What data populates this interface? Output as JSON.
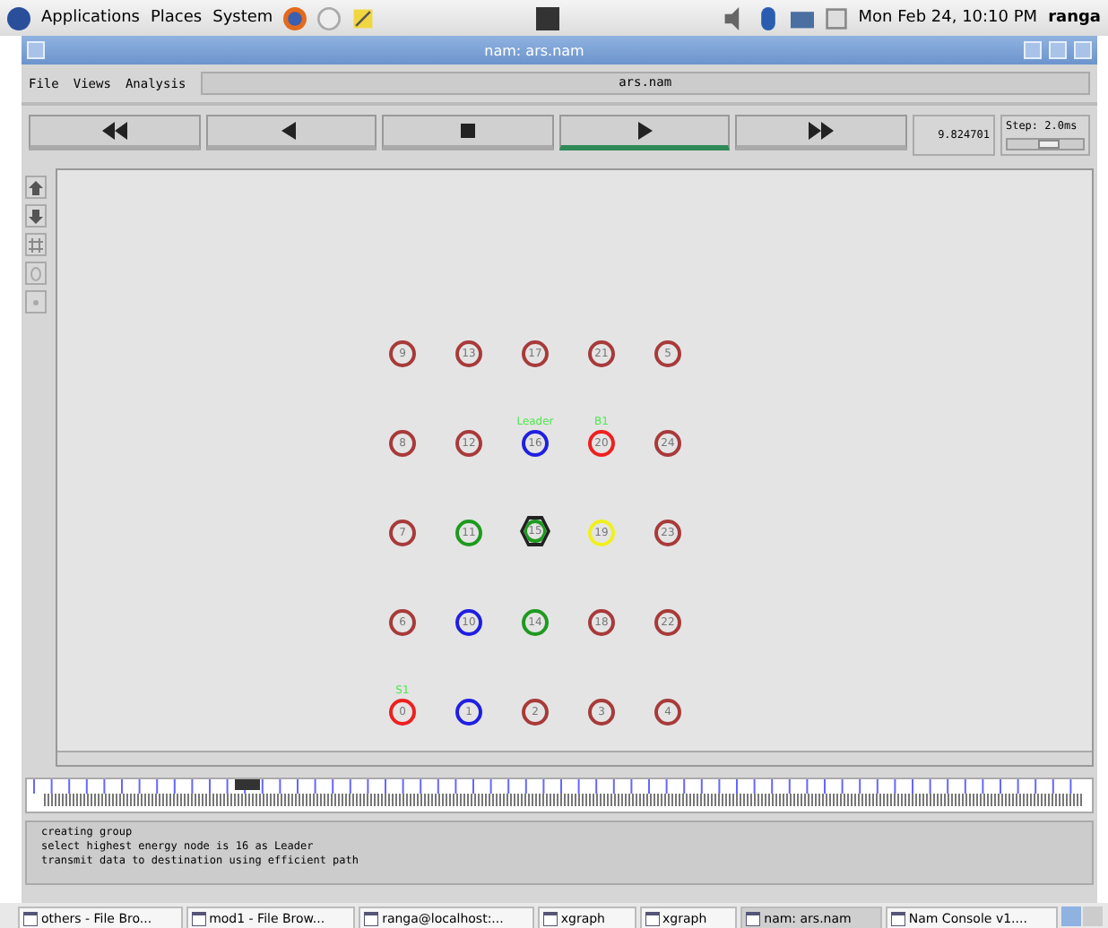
{
  "top_panel": {
    "menus": [
      "Applications",
      "Places",
      "System"
    ],
    "clock": "Mon Feb 24, 10:10 PM",
    "user": "ranga"
  },
  "window": {
    "title": "nam: ars.nam"
  },
  "menu": [
    "File",
    "Views",
    "Analysis"
  ],
  "file_label": "ars.nam",
  "controls": [
    {
      "kind": "rewind",
      "selected": false
    },
    {
      "kind": "back",
      "selected": false
    },
    {
      "kind": "stop",
      "selected": false
    },
    {
      "kind": "play",
      "selected": true
    },
    {
      "kind": "forward",
      "selected": false
    }
  ],
  "time": "9.824701",
  "step": {
    "label": "Step: 2.0ms",
    "level": 0.55
  },
  "nodes": [
    [
      {
        "label": "9",
        "color": "#a83a3a"
      },
      {
        "label": "13",
        "color": "#a83a3a"
      },
      {
        "label": "17",
        "color": "#a83a3a"
      },
      {
        "label": "21",
        "color": "#a83a3a"
      },
      {
        "label": "5",
        "color": "#a83a3a"
      }
    ],
    [
      {
        "label": "8",
        "color": "#a83a3a"
      },
      {
        "label": "12",
        "color": "#a83a3a"
      },
      {
        "label": "16",
        "color": "#1f1fe0",
        "tag": "Leader"
      },
      {
        "label": "20",
        "color": "#ee2020",
        "tag": "B1"
      },
      {
        "label": "24",
        "color": "#a83a3a"
      }
    ],
    [
      {
        "label": "7",
        "color": "#a83a3a"
      },
      {
        "label": "11",
        "color": "#1e9a1e"
      },
      {
        "label": "15",
        "color": "#1e9a1e",
        "kind": "hexagon"
      },
      {
        "label": "19",
        "color": "#f0f020"
      },
      {
        "label": "23",
        "color": "#a83a3a"
      }
    ],
    [
      {
        "label": "6",
        "color": "#a83a3a"
      },
      {
        "label": "10",
        "color": "#1f1fe0"
      },
      {
        "label": "14",
        "color": "#1e9a1e"
      },
      {
        "label": "18",
        "color": "#a83a3a"
      },
      {
        "label": "22",
        "color": "#a83a3a"
      }
    ],
    [
      {
        "label": "0",
        "color": "#ee2020",
        "tag": "S1"
      },
      {
        "label": "1",
        "color": "#1f1fe0"
      },
      {
        "label": "2",
        "color": "#a83a3a"
      },
      {
        "label": "3",
        "color": "#a83a3a"
      },
      {
        "label": "4",
        "color": "#a83a3a"
      }
    ]
  ],
  "log": [
    "creating group",
    "select highest energy node is 16 as Leader",
    "transmit data to destination using efficient path"
  ],
  "taskbar": [
    {
      "label": "others - File Bro...",
      "selected": false
    },
    {
      "label": "mod1 - File Brow...",
      "selected": false
    },
    {
      "label": "ranga@localhost:...",
      "selected": false
    },
    {
      "label": "xgraph",
      "selected": false
    },
    {
      "label": "xgraph",
      "selected": false
    },
    {
      "label": "nam: ars.nam",
      "selected": true
    },
    {
      "label": "Nam Console v1....",
      "selected": false
    }
  ]
}
